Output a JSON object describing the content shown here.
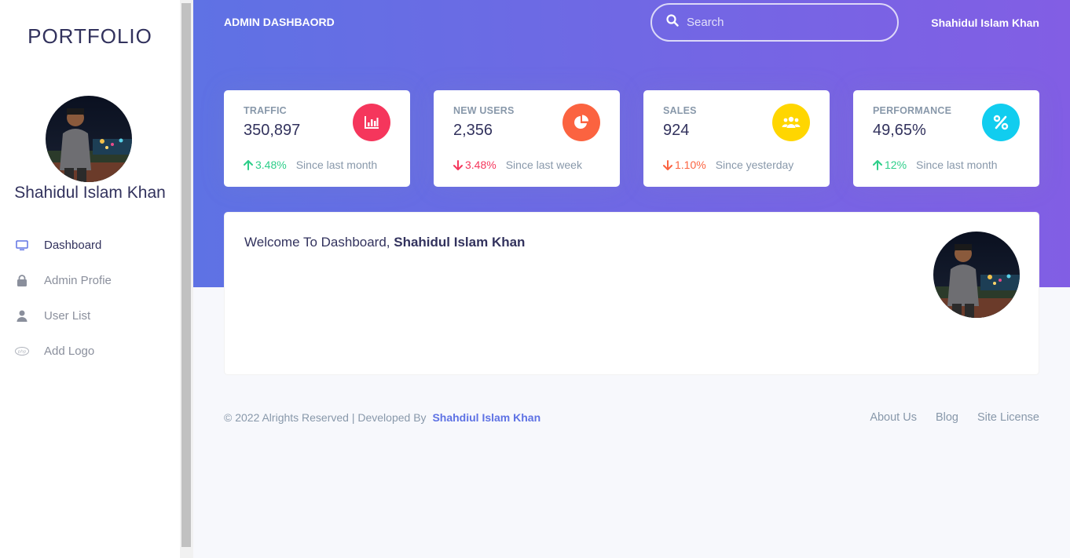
{
  "sidebar": {
    "brand": "PORTFOLIO",
    "user_name": "Shahidul Islam Khan",
    "items": [
      {
        "label": "Dashboard",
        "icon": "monitor-icon",
        "active": true
      },
      {
        "label": "Admin Profie",
        "icon": "lock-icon",
        "active": false
      },
      {
        "label": "User List",
        "icon": "user-icon",
        "active": false
      },
      {
        "label": "Add Logo",
        "icon": "php-icon",
        "active": false
      }
    ]
  },
  "header": {
    "title": "ADMIN DASHBAORD",
    "search_placeholder": "Search",
    "user_name": "Shahidul Islam Khan"
  },
  "stats": [
    {
      "title": "TRAFFIC",
      "value": "350,897",
      "change": "3.48%",
      "direction": "up",
      "since": "Since last month",
      "icon": "bar-chart-icon",
      "color": "#f5365c"
    },
    {
      "title": "NEW USERS",
      "value": "2,356",
      "change": "3.48%",
      "direction": "down",
      "since": "Since last week",
      "icon": "pie-chart-icon",
      "color": "#fb6340"
    },
    {
      "title": "SALES",
      "value": "924",
      "change": "1.10%",
      "direction": "down",
      "since": "Since yesterday",
      "icon": "users-icon",
      "color": "#ffd600"
    },
    {
      "title": "PERFORMANCE",
      "value": "49,65%",
      "change": "12%",
      "direction": "up",
      "since": "Since last month",
      "icon": "percent-icon",
      "color": "#11cdef"
    }
  ],
  "welcome": {
    "prefix": "Welcome To Dashboard, ",
    "name": "Shahidul Islam Khan"
  },
  "footer": {
    "copyright": "© 2022 Alrights Reserved | Developed By",
    "developer": "Shahdiul Islam Khan",
    "links": [
      "About Us",
      "Blog",
      "Site License"
    ]
  },
  "colors": {
    "hero_gradient_start": "#5e72e4",
    "hero_gradient_end": "#825ee4",
    "success": "#2dce89",
    "danger": "#f5365c"
  }
}
